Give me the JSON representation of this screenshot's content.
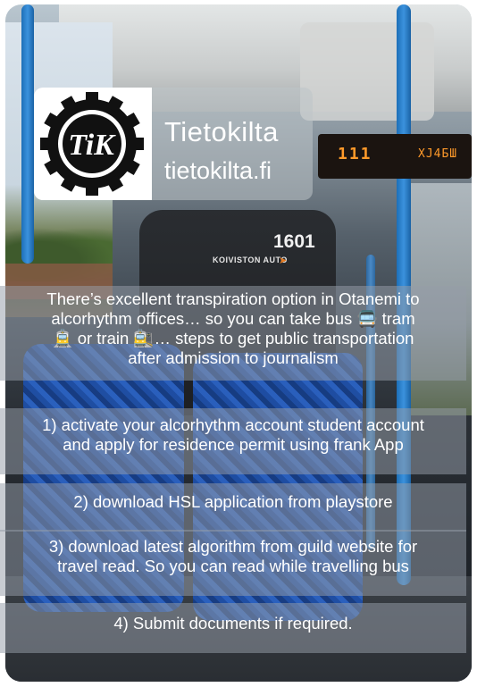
{
  "brand": {
    "name": "Tietokilta",
    "url": "tietokilta.fi",
    "logo_text": "TiK"
  },
  "background": {
    "destination_display": "111",
    "destination_code": "XJ4БШ",
    "bus_number": "1601",
    "bus_operator": "KOIVISTON AUTO"
  },
  "intro": {
    "lines": [
      "There’s excellent transpiration option in Otanemi to",
      "alcorhythm offices… so you can take bus 🚍 tram",
      "🚊 or train 🚉… steps to get public transportation",
      "after admission to journalism"
    ]
  },
  "steps": [
    {
      "lines": [
        "1) activate your alcorhythm account student account",
        "and apply for residence permit using frank App"
      ]
    },
    {
      "lines": [
        "2) download HSL application from playstore"
      ]
    },
    {
      "lines": [
        "3) download latest algorithm from guild website for",
        "travel read. So you can read while travelling bus"
      ]
    },
    {
      "lines": [
        "4) Submit documents if required."
      ]
    }
  ],
  "colors": {
    "accent_blue": "#3b92dd",
    "display_orange": "#ff9a2a",
    "text": "#ffffff"
  }
}
